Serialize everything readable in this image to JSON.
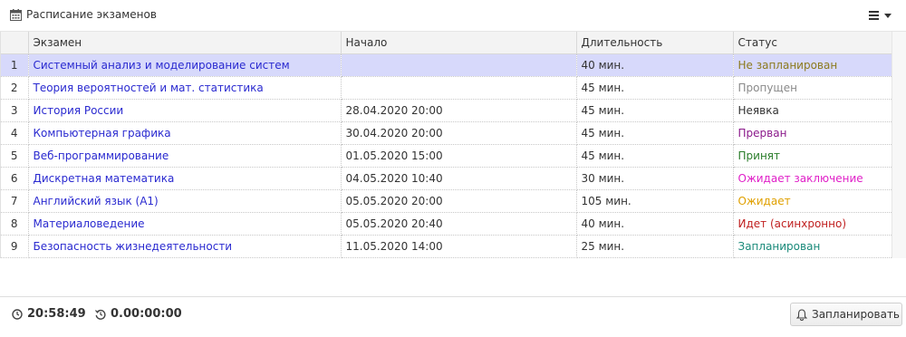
{
  "header": {
    "title": "Расписание экзаменов"
  },
  "table": {
    "columns": [
      "",
      "Экзамен",
      "Начало",
      "Длительность",
      "Статус"
    ],
    "rows": [
      {
        "num": "1",
        "exam": "Системный анализ и моделирование систем",
        "start": "",
        "duration": "40 мин.",
        "status": "Не запланирован",
        "status_color": "#8c7a1c",
        "selected": true
      },
      {
        "num": "2",
        "exam": "Теория вероятностей и мат. статистика",
        "start": "",
        "duration": "45 мин.",
        "status": "Пропущен",
        "status_color": "#8a8a8a"
      },
      {
        "num": "3",
        "exam": "История России",
        "start": "28.04.2020 20:00",
        "duration": "45 мин.",
        "status": "Неявка",
        "status_color": "#333333"
      },
      {
        "num": "4",
        "exam": "Компьютерная графика",
        "start": "30.04.2020 20:00",
        "duration": "45 мин.",
        "status": "Прерван",
        "status_color": "#8b1a8b"
      },
      {
        "num": "5",
        "exam": "Веб-программирование",
        "start": "01.05.2020 15:00",
        "duration": "45 мин.",
        "status": "Принят",
        "status_color": "#2a7d2a"
      },
      {
        "num": "6",
        "exam": "Дискретная математика",
        "start": "04.05.2020 10:40",
        "duration": "30 мин.",
        "status": "Ожидает заключение",
        "status_color": "#e020c8"
      },
      {
        "num": "7",
        "exam": "Английский язык (A1)",
        "start": "05.05.2020 20:00",
        "duration": "105 мин.",
        "status": "Ожидает",
        "status_color": "#e0a000"
      },
      {
        "num": "8",
        "exam": "Материаловедение",
        "start": "05.05.2020 20:40",
        "duration": "40 мин.",
        "status": "Идет (асинхронно)",
        "status_color": "#c02020"
      },
      {
        "num": "9",
        "exam": "Безопасность жизнедеятельности",
        "start": "11.05.2020 14:00",
        "duration": "25 мин.",
        "status": "Запланирован",
        "status_color": "#1a8a7a"
      }
    ]
  },
  "footer": {
    "time": "20:58:49",
    "elapsed": "0.00:00:00",
    "schedule_label": "Запланировать"
  },
  "icons": {
    "header": "calendar-icon",
    "menu": "hamburger-menu-icon",
    "time": "clock-icon",
    "elapsed": "history-icon",
    "button": "bell-icon"
  }
}
